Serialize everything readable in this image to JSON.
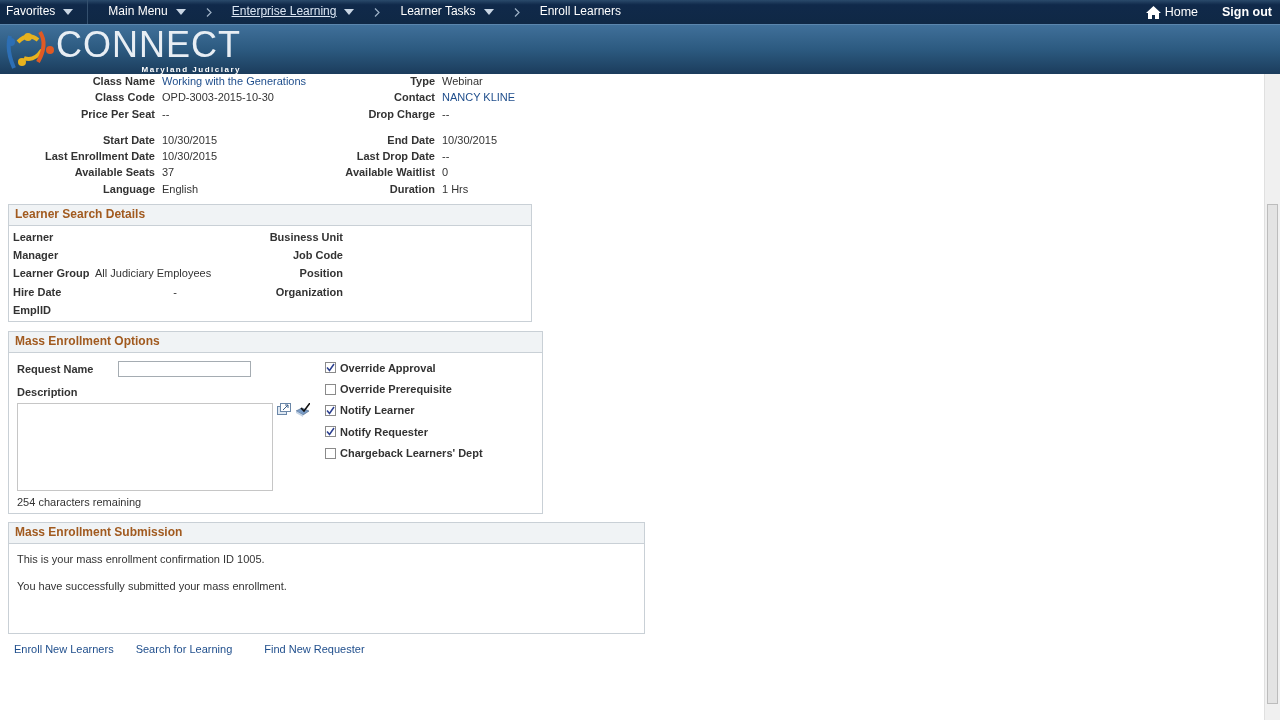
{
  "top_nav": {
    "items": [
      {
        "label": "Favorites",
        "dropdown": true,
        "link": false,
        "chevron_before": false
      },
      {
        "label": "Main Menu",
        "dropdown": true,
        "link": false,
        "chevron_before": false
      },
      {
        "label": "Enterprise Learning",
        "dropdown": true,
        "link": true,
        "chevron_before": true
      },
      {
        "label": "Learner Tasks",
        "dropdown": true,
        "link": false,
        "chevron_before": true
      },
      {
        "label": "Enroll Learners",
        "dropdown": false,
        "link": false,
        "chevron_before": true
      }
    ],
    "home": "Home",
    "sign_out": "Sign out"
  },
  "banner": {
    "logo_text": "CONNECT",
    "logo_subtitle": "Maryland Judiciary"
  },
  "class_details": {
    "groups": [
      [
        [
          {
            "label": "Class Name",
            "value": "Working with the Generations",
            "kind": "link"
          },
          {
            "label": "Type",
            "value": "Webinar",
            "kind": "text"
          }
        ],
        [
          {
            "label": "Class Code",
            "value": "OPD-3003-2015-10-30",
            "kind": "text"
          },
          {
            "label": "Contact",
            "value": "NANCY KLINE",
            "kind": "link"
          }
        ],
        [
          {
            "label": "Price Per Seat",
            "value": "--",
            "kind": "text"
          },
          {
            "label": "Drop Charge",
            "value": "--",
            "kind": "text"
          }
        ]
      ],
      [
        [
          {
            "label": "Start Date",
            "value": "10/30/2015",
            "kind": "text"
          },
          {
            "label": "End Date",
            "value": "10/30/2015",
            "kind": "text"
          }
        ],
        [
          {
            "label": "Last Enrollment Date",
            "value": "10/30/2015",
            "kind": "text"
          },
          {
            "label": "Last Drop Date",
            "value": "--",
            "kind": "text"
          }
        ],
        [
          {
            "label": "Available Seats",
            "value": "37",
            "kind": "text"
          },
          {
            "label": "Available Waitlist",
            "value": "0",
            "kind": "text"
          }
        ],
        [
          {
            "label": "Language",
            "value": "English",
            "kind": "text"
          },
          {
            "label": "Duration",
            "value": "1 Hrs",
            "kind": "text"
          }
        ]
      ]
    ]
  },
  "learner_search": {
    "title": "Learner Search Details",
    "left": [
      {
        "label": "Learner"
      },
      {
        "label": "Manager"
      },
      {
        "label": "Learner Group",
        "value": "All Judiciary Employees"
      },
      {
        "label": "Hire Date",
        "value": "-"
      },
      {
        "label": "EmplID"
      }
    ],
    "right": [
      {
        "label": "Business Unit"
      },
      {
        "label": "Job Code"
      },
      {
        "label": "Position"
      },
      {
        "label": "Organization"
      }
    ]
  },
  "mass_enrollment_options": {
    "title": "Mass Enrollment Options",
    "request_name_label": "Request Name",
    "description_label": "Description",
    "characters_remaining": "254 characters remaining",
    "checkboxes": [
      {
        "label": "Override Approval",
        "checked": true
      },
      {
        "label": "Override Prerequisite",
        "checked": false
      },
      {
        "label": "Notify Learner",
        "checked": true
      },
      {
        "label": "Notify Requester",
        "checked": true
      },
      {
        "label": "Chargeback Learners' Dept",
        "checked": false
      }
    ]
  },
  "mass_enrollment_submission": {
    "title": "Mass Enrollment Submission",
    "messages": [
      "This is your mass enrollment confirmation ID 1005.",
      "You have successfully submitted your mass enrollment."
    ]
  },
  "links": [
    "Enroll New Learners",
    "Search for Learning",
    "Find New Requester"
  ]
}
